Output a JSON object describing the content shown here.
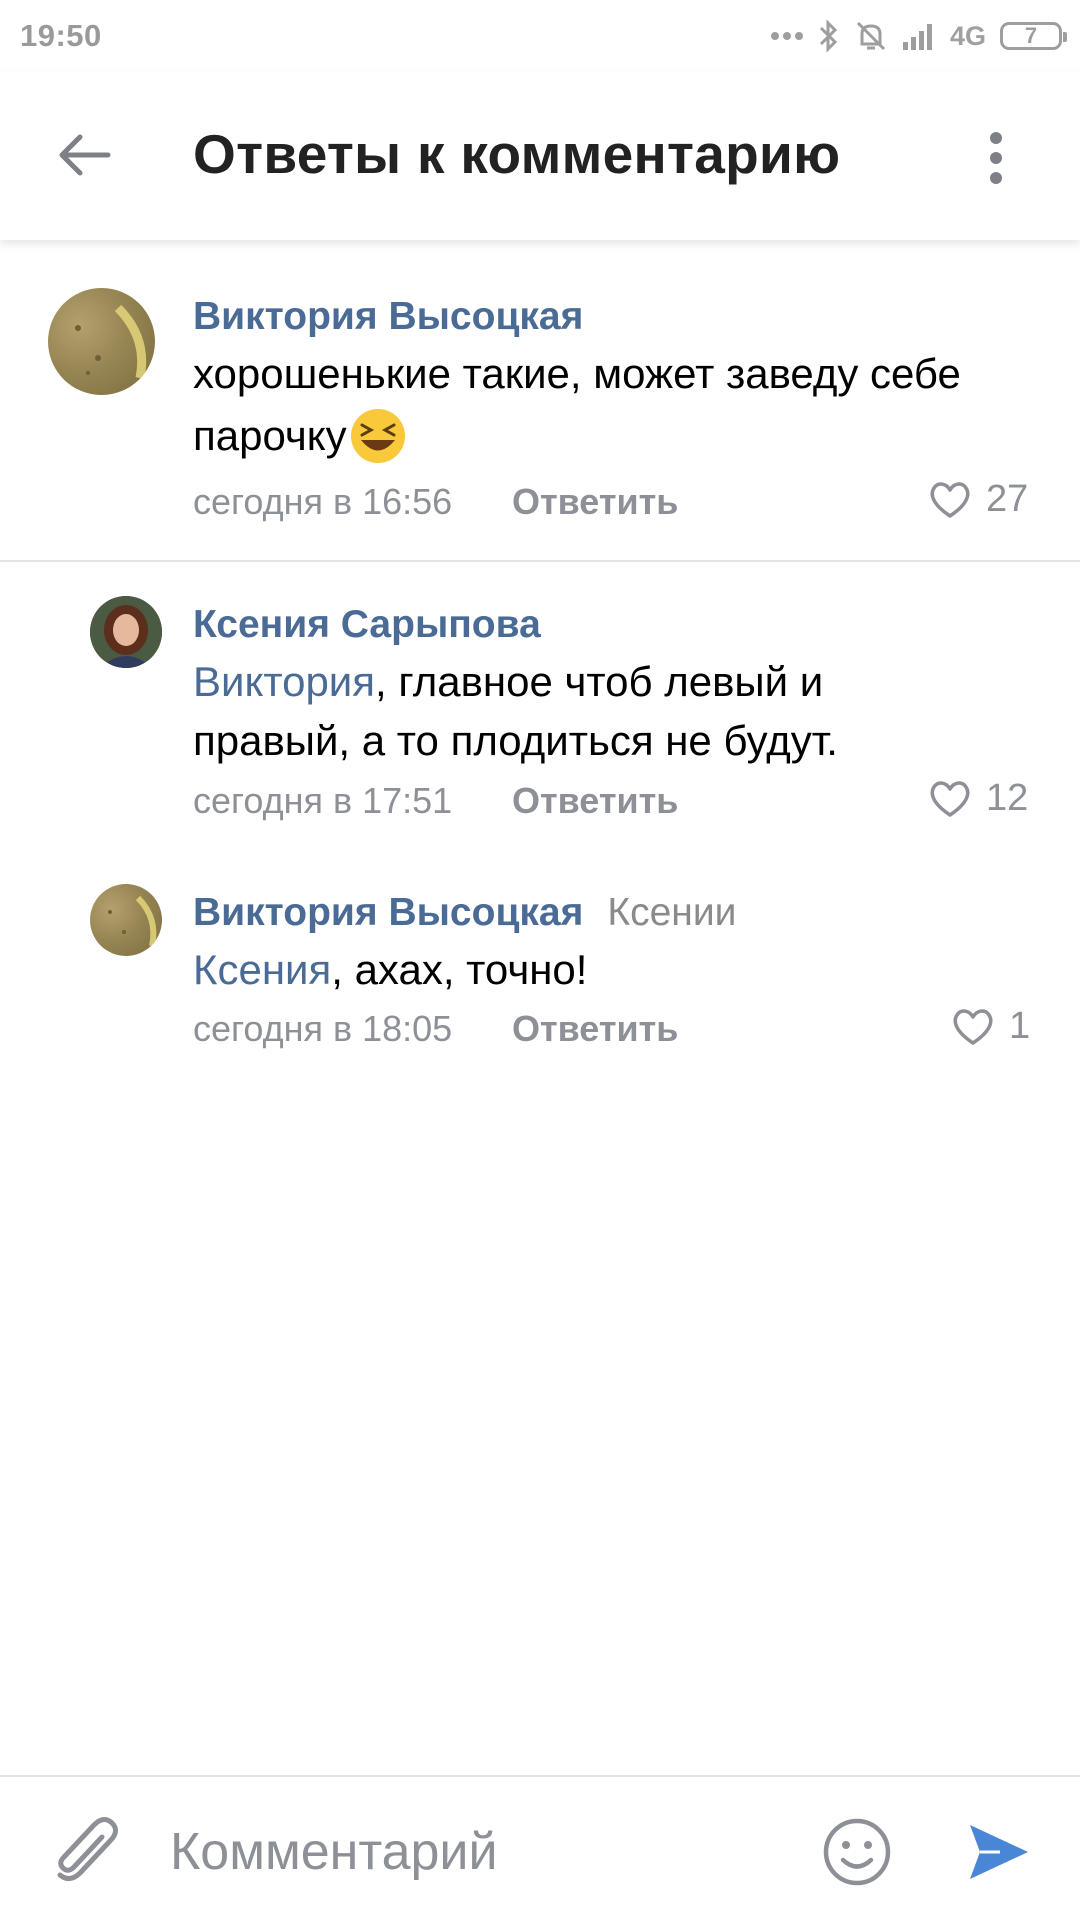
{
  "status_bar": {
    "time": "19:50",
    "network": "4G",
    "battery": "7"
  },
  "header": {
    "title": "Ответы к комментарию"
  },
  "comments": [
    {
      "author": "Виктория Высоцкая",
      "text": "хорошенькие такие, может заведу себе",
      "text_line2": "парочку",
      "time": "сегодня в 16:56",
      "reply_label": "Ответить",
      "likes": "27"
    },
    {
      "author": "Ксения Сарыпова",
      "mention": "Виктория",
      "text": ", главное чтоб левый и",
      "text_line2": "правый, а то плодиться не будут.",
      "time": "сегодня в 17:51",
      "reply_label": "Ответить",
      "likes": "12"
    },
    {
      "author": "Виктория Высоцкая",
      "reply_to": "Ксении",
      "mention": "Ксения",
      "text": ", ахах, точно!",
      "time": "сегодня в 18:05",
      "reply_label": "Ответить",
      "likes": "1"
    }
  ],
  "composer": {
    "placeholder": "Комментарий"
  },
  "colors": {
    "link": "#4a6b95",
    "muted": "#8d9096",
    "send": "#4a86d6"
  },
  "icons": [
    "back-arrow-icon",
    "more-vertical-icon",
    "heart-icon",
    "paperclip-icon",
    "smiley-icon",
    "send-icon",
    "laughing-emoji-icon"
  ]
}
